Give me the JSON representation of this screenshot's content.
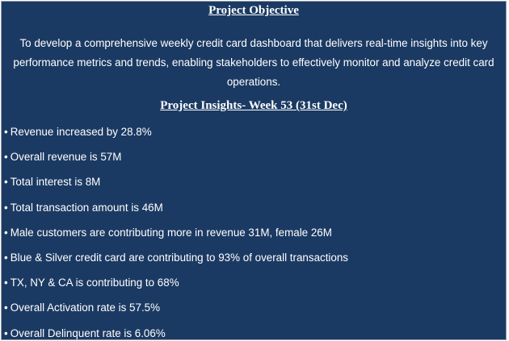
{
  "objective": {
    "title": "Project Objective",
    "text": "To develop a comprehensive weekly credit card dashboard that delivers real-time insights into key performance metrics and trends, enabling stakeholders to effectively monitor and analyze credit card operations."
  },
  "insights": {
    "title": "Project Insights- Week 53 (31st Dec)",
    "bullet_symbol": "•",
    "items": [
      "Revenue increased by 28.8%",
      "Overall revenue is 57M",
      "Total interest is 8M",
      "Total transaction amount is 46M",
      "Male customers are contributing more in revenue 31M, female 26M",
      "Blue & Silver credit card are contributing to 93% of overall transactions",
      "TX, NY & CA is contributing to 68%",
      "Overall Activation rate is 57.5%",
      "Overall Delinquent rate is 6.06%"
    ]
  },
  "colors": {
    "background": "#1b3a63",
    "text": "#ffffff",
    "border": "#9aa3ad"
  }
}
